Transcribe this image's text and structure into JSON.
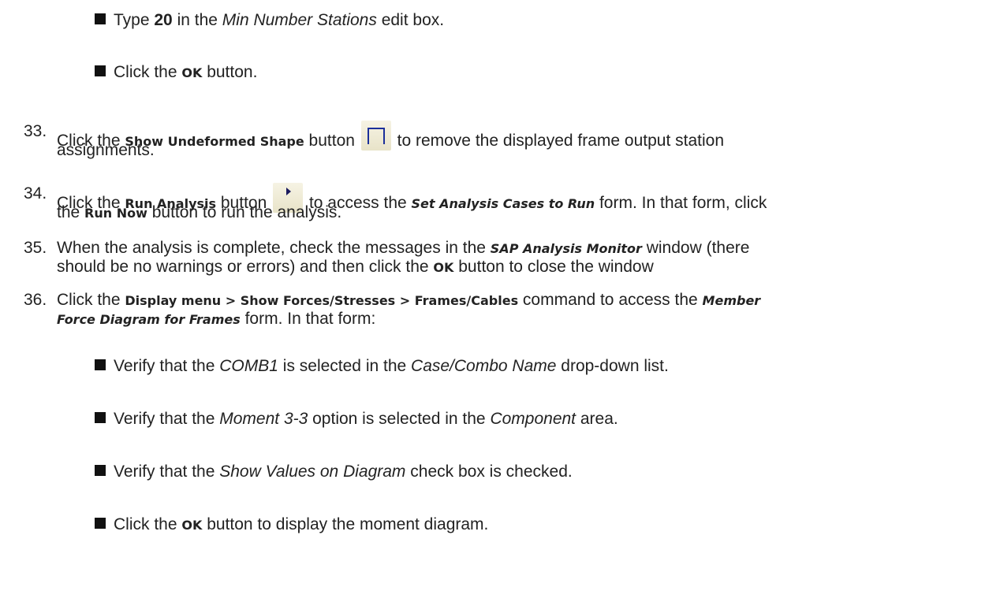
{
  "bullets_top": [
    {
      "pre": "Type ",
      "bold": "20",
      "mid": " in the ",
      "italic": "Min Number Stations",
      "post": " edit box."
    },
    {
      "pre": "Click the ",
      "ui": "OK",
      "post": " button."
    }
  ],
  "steps": {
    "s33": {
      "num": "33.",
      "t1": "Click the ",
      "ui1": "Show Undeformed Shape",
      "t2": " button ",
      "t3": " to remove the displayed frame output station",
      "line2": "assignments."
    },
    "s34": {
      "num": "34.",
      "t1": "Click the ",
      "ui1": "Run Analysis",
      "t2": " button ",
      "t3": " to access the ",
      "uii1": "Set Analysis Cases to Run",
      "t4": " form. In that form, click",
      "l2a": "the ",
      "ui2": "Run Now",
      "l2b": " button to run the analysis."
    },
    "s35": {
      "num": "35.",
      "t1": "When the analysis is complete, check the messages in the ",
      "uii1": "SAP Analysis Monitor",
      "t2": " window (there",
      "l2a": "should be no warnings or errors) and then click the ",
      "ui2": "OK",
      "l2b": " button to close the window"
    },
    "s36": {
      "num": "36.",
      "t1": "Click the ",
      "ui1": "Display menu > Show Forces/Stresses > Frames/Cables",
      "t2": " command to access the ",
      "uii1": "Member",
      "uii2": "Force Diagram for Frames",
      "l2b": " form. In that form:"
    }
  },
  "bullets_bottom": [
    {
      "pre": "Verify that the ",
      "i1": "COMB1",
      "mid": " is selected in the ",
      "i2": "Case/Combo Name",
      "post": " drop-down list."
    },
    {
      "pre": "Verify that the ",
      "i1": "Moment 3-3",
      "mid": " option is selected in the ",
      "i2": "Component",
      "post": " area."
    },
    {
      "pre": "Verify that the ",
      "i1": "Show Values on Diagram",
      "post": " check box is checked."
    },
    {
      "pre": "Click the ",
      "ui": "OK",
      "post": " button to display the moment diagram."
    }
  ],
  "icons": {
    "undeformed": "show-undeformed-shape-icon",
    "run": "run-analysis-icon"
  }
}
